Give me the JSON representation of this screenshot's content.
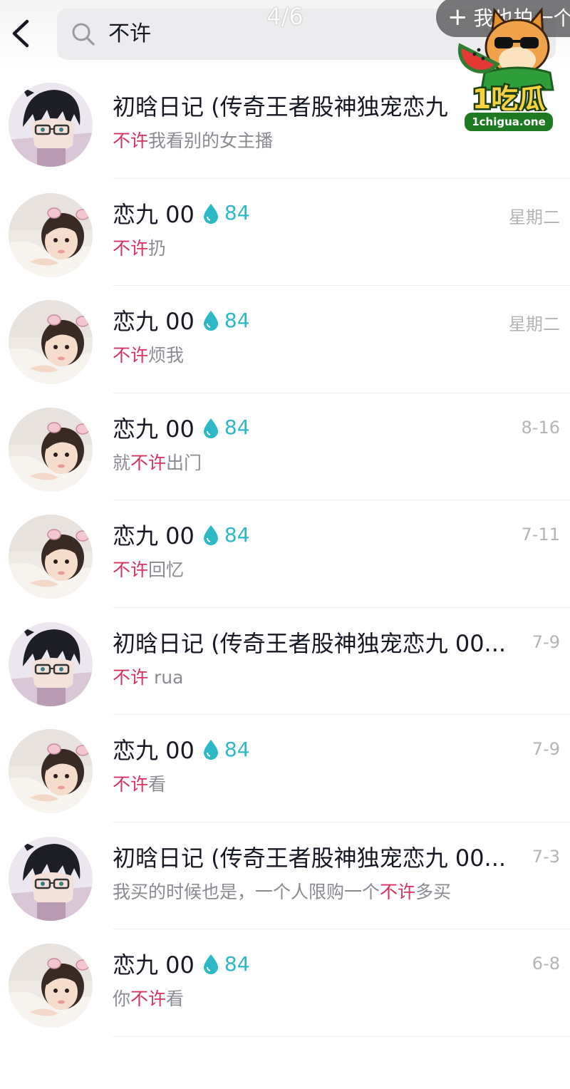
{
  "top_bar": {
    "search_value": "不许",
    "page_indicator": "4/6",
    "me_too_label": "我也拍一个"
  },
  "watermark": {
    "text": "1吃瓜",
    "url": "1chigua.one"
  },
  "results": [
    {
      "avatar": "avatar-boy",
      "name": "初晗日记 (传奇王者股神独宠恋九",
      "level": "",
      "date": "",
      "preview_pre": "",
      "preview_hl": "不许",
      "preview_post": "我看别的女主播"
    },
    {
      "avatar": "avatar-girl",
      "name": "恋九 00",
      "level": "84",
      "date": "星期二",
      "preview_pre": "",
      "preview_hl": "不许",
      "preview_post": "扔"
    },
    {
      "avatar": "avatar-girl",
      "name": "恋九 00",
      "level": "84",
      "date": "星期二",
      "preview_pre": "",
      "preview_hl": "不许",
      "preview_post": "烦我"
    },
    {
      "avatar": "avatar-girl",
      "name": "恋九 00",
      "level": "84",
      "date": "8-16",
      "preview_pre": "就",
      "preview_hl": "不许",
      "preview_post": "出门"
    },
    {
      "avatar": "avatar-girl",
      "name": "恋九 00",
      "level": "84",
      "date": "7-11",
      "preview_pre": "",
      "preview_hl": "不许",
      "preview_post": "回忆"
    },
    {
      "avatar": "avatar-boy",
      "name": "初晗日记 (传奇王者股神独宠恋九 00...",
      "level": "",
      "date": "7-9",
      "preview_pre": "",
      "preview_hl": "不许",
      "preview_post": " rua"
    },
    {
      "avatar": "avatar-girl",
      "name": "恋九 00",
      "level": "84",
      "date": "7-9",
      "preview_pre": "",
      "preview_hl": "不许",
      "preview_post": "看"
    },
    {
      "avatar": "avatar-boy",
      "name": "初晗日记 (传奇王者股神独宠恋九 00...",
      "level": "",
      "date": "7-3",
      "preview_pre": "我买的时候也是，一个人限购一个",
      "preview_hl": "不许",
      "preview_post": "多买"
    },
    {
      "avatar": "avatar-girl",
      "name": "恋九 00",
      "level": "84",
      "date": "6-8",
      "preview_pre": "你",
      "preview_hl": "不许",
      "preview_post": "看"
    }
  ],
  "colors": {
    "highlight": "#d9315e",
    "level_badge": "#2cb8c7",
    "secondary_text": "#8a8b91",
    "date_text": "#b3b4b8"
  }
}
